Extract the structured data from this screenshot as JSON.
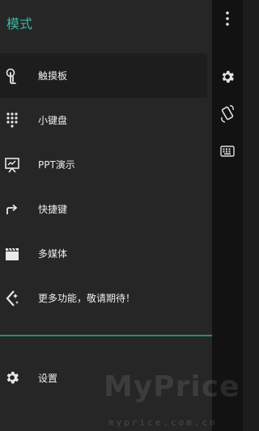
{
  "drawer": {
    "title": "模式",
    "items": [
      {
        "label": "触摸板",
        "icon": "touch-icon",
        "active": true
      },
      {
        "label": "小键盘",
        "icon": "keypad-icon",
        "active": false
      },
      {
        "label": "PPT演示",
        "icon": "presentation-icon",
        "active": false
      },
      {
        "label": "快捷键",
        "icon": "shortcut-arrow-icon",
        "active": false
      },
      {
        "label": "多媒体",
        "icon": "clapperboard-icon",
        "active": false
      },
      {
        "label": "更多功能，敬请期待！",
        "icon": "more-features-icon",
        "active": false
      }
    ],
    "settings": {
      "label": "设置",
      "icon": "gear-icon"
    }
  },
  "rail": {
    "icons": [
      "more-vert-icon",
      "gear-icon",
      "screen-rotate-icon",
      "keyboard-icon"
    ]
  },
  "watermark": {
    "main": "MyPrice",
    "url": "myprice.com.cn"
  },
  "colors": {
    "accent": "#3cb8a4",
    "divider": "#1f8f7c",
    "drawer_bg": "#262626",
    "rail_bg": "#121212"
  }
}
